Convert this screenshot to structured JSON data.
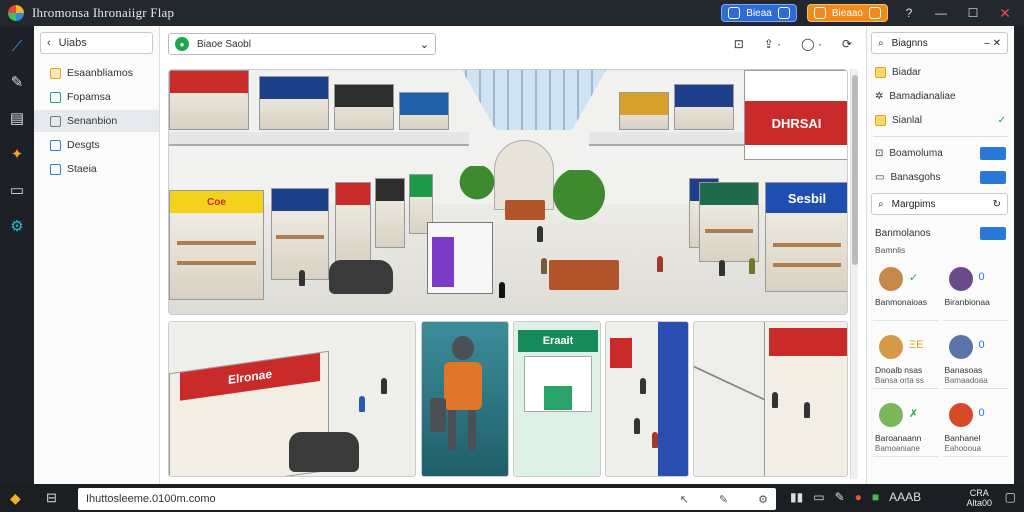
{
  "window": {
    "title": "Ihromonsa Ihronaiigr Flap"
  },
  "titlebar": {
    "pill_blue": "Bieaa",
    "pill_orange": "Bieaao"
  },
  "sidebar": {
    "search": "Uiabs",
    "items": [
      {
        "label": "Esaanbliamos",
        "color": "#e8a21b",
        "active": false
      },
      {
        "label": "Fopamsa",
        "color": "#20a07a",
        "active": false
      },
      {
        "label": "Senanbion",
        "color": "#5b8b6a",
        "active": true
      },
      {
        "label": "Desgts",
        "color": "#2b7fd6",
        "active": false
      },
      {
        "label": "Staeia",
        "color": "#2b7fd6",
        "active": false
      }
    ]
  },
  "main": {
    "address": "Biaoe Saobl",
    "hero_signs": [
      "DHRSAI",
      "Sesbil",
      "Coe"
    ],
    "thumb_signs": [
      "Elronae",
      "Eraait"
    ]
  },
  "right_panel": {
    "search": "Biagnns",
    "top_items": [
      {
        "label": "Biadar",
        "icon_color": "#e8a21b"
      },
      {
        "label": "Bamadianaliae",
        "icon_color": "#333333"
      },
      {
        "label": "Sianlal",
        "icon_color": "#e8a21b",
        "check": "✓"
      }
    ],
    "mid_items": [
      {
        "label": "Boamoluma"
      },
      {
        "label": "Banasgohs"
      }
    ],
    "search2": "Margpims",
    "section_label": "Banmolanos",
    "section_sub": "Bamnlis",
    "cards": [
      {
        "l1": "Banmonaioas",
        "l2": "",
        "mark": "✓",
        "color": "#c58a4a"
      },
      {
        "l1": "Biranbionaa",
        "l2": "",
        "mark": "0",
        "color": "#6a4a8a"
      },
      {
        "l1": "Dnoalb nsas",
        "l2": "Bansa orta ss",
        "mark": "ΞΕ",
        "color": "#d49a4a"
      },
      {
        "l1": "Banasoas",
        "l2": "Bamaadoaa",
        "mark": "0",
        "color": "#5a74a8"
      },
      {
        "l1": "Baroanaann",
        "l2": "Bamoaniane",
        "mark": "✗",
        "color": "#7ab65a"
      },
      {
        "l1": "Banhanel",
        "l2": "Eahoooua",
        "mark": "0",
        "color": "#d64a2a"
      }
    ]
  },
  "taskbar": {
    "address": "Ihuttosleeme.0100m.como",
    "tray_text": "AAAB",
    "clock_line1": "CRA",
    "clock_line2": "Alta00"
  }
}
